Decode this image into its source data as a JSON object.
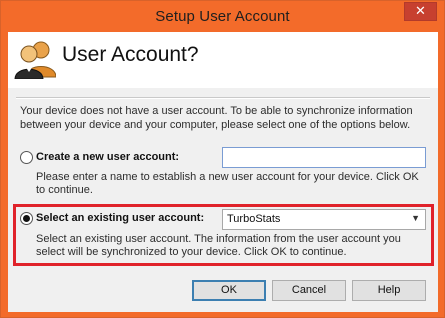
{
  "window": {
    "title": "Setup User Account",
    "close_label": "✕"
  },
  "header": {
    "title": "User Account?",
    "avatar_icon": "users-icon"
  },
  "intro_text": "Your device does not have a user account. To be able to synchronize information between your device and your computer, please select one of the options below.",
  "options": {
    "create": {
      "label": "Create a new user account:",
      "selected": false,
      "description": "Please enter a name to establish a new user account for your device. Click OK to continue.",
      "input_value": ""
    },
    "existing": {
      "label": "Select an existing user account:",
      "selected": true,
      "description": "Select an existing user account. The information from the user account you select will be synchronized to your device. Click OK to continue.",
      "selected_value": "TurboStats"
    }
  },
  "buttons": {
    "ok": "OK",
    "cancel": "Cancel",
    "help": "Help"
  },
  "colors": {
    "frame": "#f36b2a",
    "highlight": "#e0222a",
    "close": "#c7402f"
  }
}
